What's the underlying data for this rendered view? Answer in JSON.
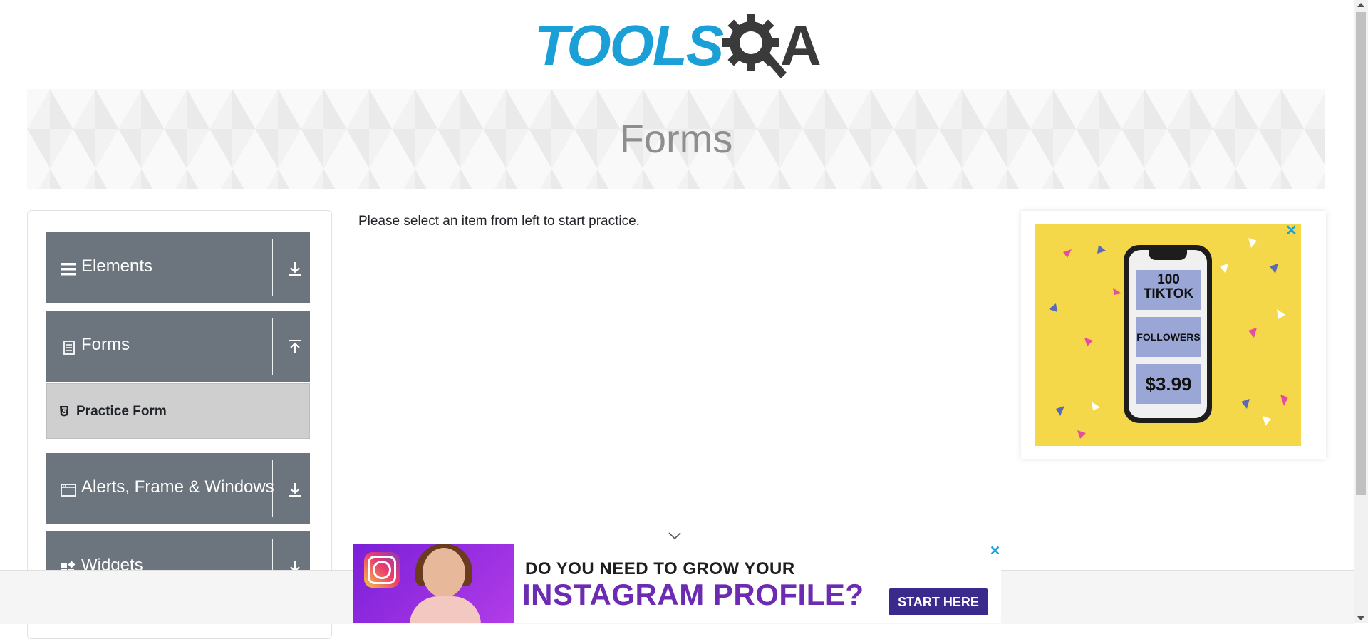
{
  "logo": {
    "text_tools": "TOOLS",
    "text_a": "A",
    "colors": {
      "tools": "#1a9fd6",
      "qa": "#3a3a3a"
    }
  },
  "banner": {
    "title": "Forms"
  },
  "sidebar": {
    "groups": [
      {
        "label": "Elements",
        "icon": "hamburger-icon",
        "arrow": "download-arrow-icon"
      },
      {
        "label": "Forms",
        "icon": "document-icon",
        "arrow": "upload-arrow-icon",
        "items": [
          {
            "label": "Practice Form",
            "icon": "html5-icon"
          }
        ]
      },
      {
        "label": "Alerts, Frame & Windows",
        "icon": "window-icon",
        "arrow": "download-arrow-icon"
      },
      {
        "label": "Widgets",
        "icon": "widgets-icon",
        "arrow": "download-arrow-icon"
      }
    ]
  },
  "main": {
    "instruction": "Please select an item from left to start practice."
  },
  "ad_right": {
    "close": "✕",
    "cards": [
      "100 TIKTOK",
      "FOLLOWERS",
      "$3.99"
    ],
    "background": "#f5d84a"
  },
  "ad_bottom": {
    "close": "✕",
    "line1": "DO YOU NEED TO GROW YOUR",
    "line2": "INSTAGRAM PROFILE?",
    "cta": "START HERE"
  },
  "colors": {
    "sidebar_header": "#6c757d",
    "active_item": "#cfcfcf",
    "accent": "#1a9fd6"
  }
}
